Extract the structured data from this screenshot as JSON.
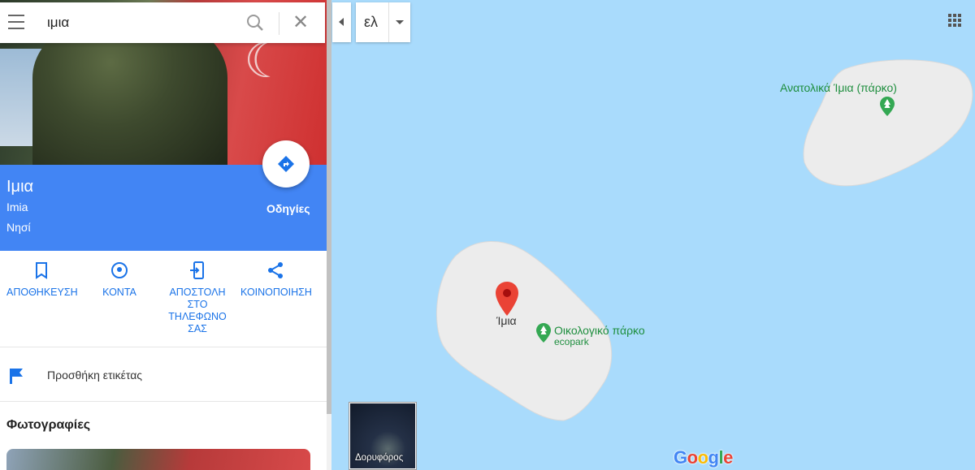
{
  "search": {
    "query": "ιμια"
  },
  "place": {
    "name": "Ιμια",
    "latin_name": "Imia",
    "type": "Νησί",
    "directions_label": "Οδηγίες"
  },
  "actions": [
    {
      "label": "ΑΠΟΘΗΚΕΥΣΗ",
      "icon": "bookmark-icon"
    },
    {
      "label": "ΚΟΝΤΑ",
      "icon": "nearby-icon"
    },
    {
      "label": "ΑΠΟΣΤΟΛΗ ΣΤΟ ΤΗΛΕΦΩΝΟ ΣΑΣ",
      "icon": "send-to-phone-icon"
    },
    {
      "label": "ΚΟΙΝΟΠΟΙΗΣΗ",
      "icon": "share-icon"
    }
  ],
  "add_label": "Προσθήκη ετικέτας",
  "photos_title": "Φωτογραφίες",
  "map": {
    "language_label": "ελ",
    "labels": {
      "east_park": "Ανατολικά Ίμια (πάρκο)",
      "pin": "Ίμια",
      "eco_park": "Οικολογικό πάρκο",
      "eco_park_sub": "ecopark"
    },
    "satellite_label": "Δορυφόρος",
    "logo": "Google"
  },
  "colors": {
    "accent_blue": "#4285f4",
    "water": "#a9dbfc",
    "land": "#ececec",
    "park_green": "#1e8e3e",
    "pin_red": "#ea4335"
  }
}
